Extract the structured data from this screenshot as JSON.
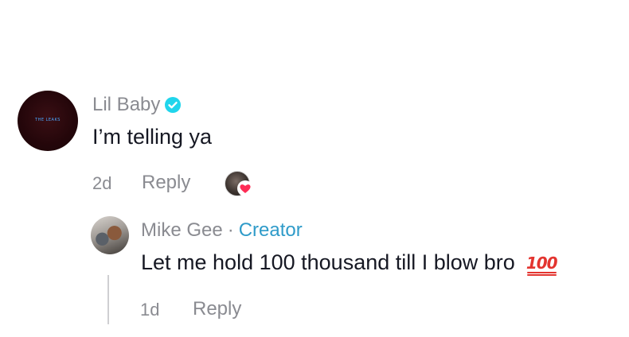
{
  "comment": {
    "avatar_text": "THE LEAKS",
    "username": "Lil Baby",
    "verified": true,
    "text": "I’m telling ya",
    "time": "2d",
    "reply_label": "Reply",
    "liked_by_creator": true
  },
  "reply": {
    "username": "Mike Gee",
    "separator": "·",
    "badge": "Creator",
    "text": "Let me hold 100 thousand till I blow bro",
    "emoji": "💯",
    "emoji_label": "100",
    "time": "1d",
    "reply_label": "Reply"
  },
  "colors": {
    "muted": "#8a8b91",
    "text": "#161823",
    "creator": "#2f9bc9",
    "verified": "#20d5ec",
    "heart": "#fe2c55"
  }
}
